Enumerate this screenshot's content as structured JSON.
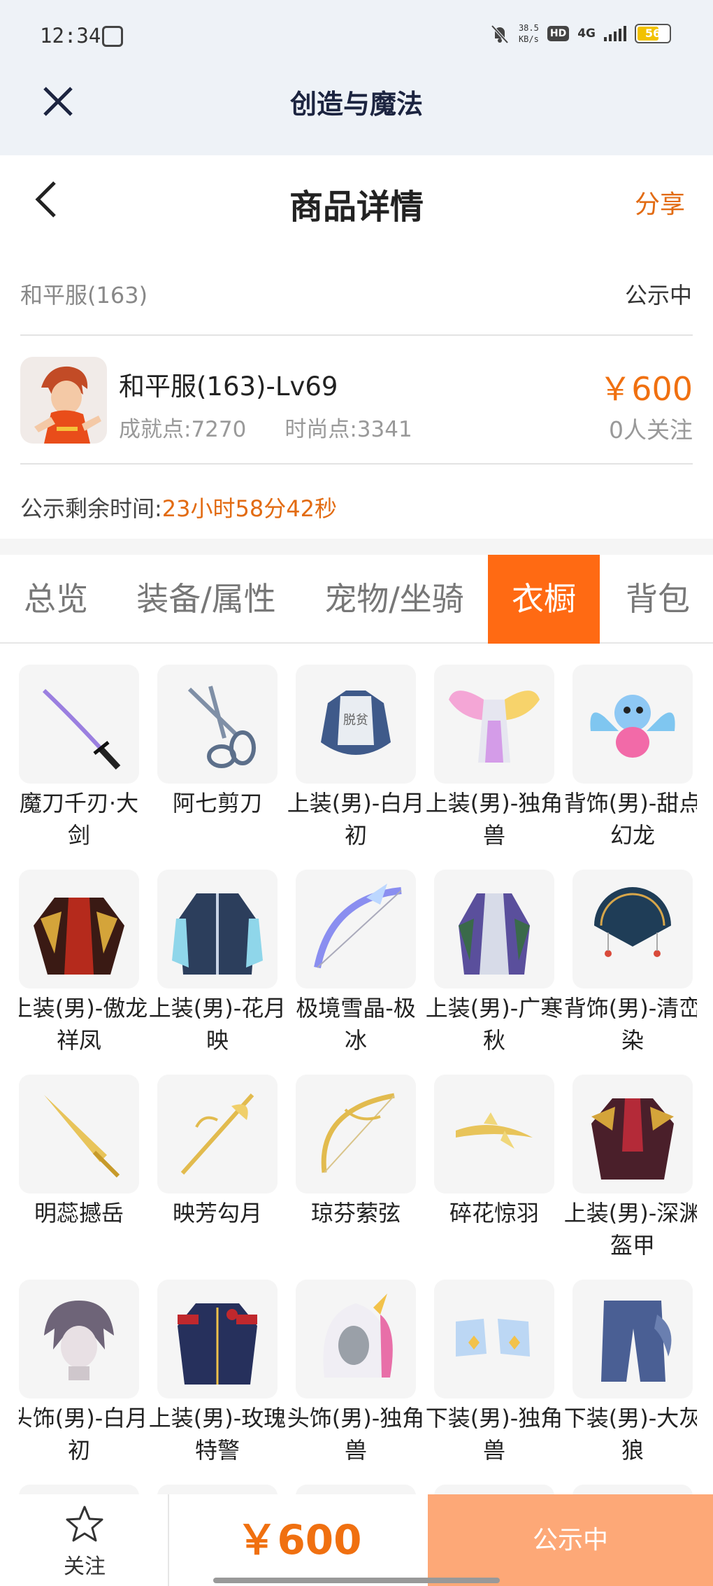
{
  "status_bar": {
    "time": "12:34",
    "net_speed_value": "38.5",
    "net_speed_unit": "KB/s",
    "hd": "HD",
    "signal": "4G",
    "battery": "56"
  },
  "app": {
    "title": "创造与魔法"
  },
  "page": {
    "title": "商品详情",
    "share_label": "分享"
  },
  "listing": {
    "server": "和平服(163)",
    "status": "公示中",
    "role_name": "和平服(163)-Lv69",
    "achievement": "成就点:7270",
    "fashion": "时尚点:3341",
    "price": "￥600",
    "followers": "0人关注",
    "remaining_label": "公示剩余时间:",
    "remaining_value": "23小时58分42秒"
  },
  "tabs": [
    {
      "label": "总览"
    },
    {
      "label": "装备/属性"
    },
    {
      "label": "宠物/坐骑"
    },
    {
      "label": "衣橱",
      "active": true
    },
    {
      "label": "背包"
    }
  ],
  "wardrobe_items": [
    {
      "name": "魔刀千刃·大剑",
      "icon": "katana-icon"
    },
    {
      "name": "阿七剪刀",
      "icon": "scissors-icon"
    },
    {
      "name": "上装(男)-白月初",
      "icon": "top-garment-icon"
    },
    {
      "name": "上装(男)-独角兽",
      "icon": "winged-top-icon"
    },
    {
      "name": "背饰(男)-甜点幻龙",
      "icon": "baby-dragon-icon"
    },
    {
      "name": "上装(男)-傲龙祥凤",
      "icon": "dragon-robe-icon"
    },
    {
      "name": "上装(男)-花月映",
      "icon": "coat-icon"
    },
    {
      "name": "极境雪晶-极冰",
      "icon": "ice-bow-icon"
    },
    {
      "name": "上装(男)-广寒秋",
      "icon": "robe-icon"
    },
    {
      "name": "背饰(男)-清峦染",
      "icon": "fan-icon"
    },
    {
      "name": "明蕊撼岳",
      "icon": "golden-sword-icon"
    },
    {
      "name": "映芳勾月",
      "icon": "golden-staff-icon"
    },
    {
      "name": "琼芬萦弦",
      "icon": "golden-bow-icon"
    },
    {
      "name": "碎花惊羽",
      "icon": "golden-blade-icon"
    },
    {
      "name": "上装(男)-深渊盔甲",
      "icon": "armor-icon"
    },
    {
      "name": "头饰(男)-白月初",
      "icon": "hair-icon"
    },
    {
      "name": "上装(男)-玫瑰特警",
      "icon": "uniform-icon"
    },
    {
      "name": "头饰(男)-独角兽",
      "icon": "unicorn-hood-icon"
    },
    {
      "name": "下装(男)-独角兽",
      "icon": "boots-icon"
    },
    {
      "name": "下装(男)-大灰狼",
      "icon": "pants-icon"
    }
  ],
  "bottom_bar": {
    "follow_label": "关注",
    "price": "￥600",
    "action_label": "公示中"
  },
  "colors": {
    "accent": "#ff6a13",
    "price": "#f07010",
    "action_disabled": "#fda877"
  }
}
